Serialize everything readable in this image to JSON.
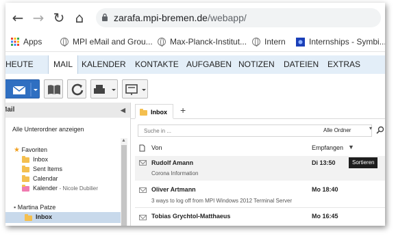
{
  "browser": {
    "url_host": "zarafa.mpi-bremen.de",
    "url_path": "/webapp/",
    "bookmarks": [
      {
        "label": "Apps",
        "icon": "apps-grid-icon"
      },
      {
        "label": "MPI eMail and Grou...",
        "icon": "globe-icon"
      },
      {
        "label": "Max-Planck-Institut...",
        "icon": "globe-icon"
      },
      {
        "label": "Intern",
        "icon": "globe-icon"
      },
      {
        "label": "Internships - Symbi...",
        "icon": "bookmark-favicon-icon"
      }
    ]
  },
  "nav": {
    "tabs": [
      "HEUTE",
      "MAIL",
      "KALENDER",
      "KONTAKTE",
      "AUFGABEN",
      "NOTIZEN",
      "DATEIEN",
      "EXTRAS"
    ],
    "active": "MAIL"
  },
  "left": {
    "header": "Mail",
    "show_subfolders": "Alle Unterordner anzeigen",
    "favorites_label": "Favoriten",
    "favorites": [
      {
        "label": "Inbox",
        "extra": ""
      },
      {
        "label": "Sent Items",
        "extra": ""
      },
      {
        "label": "Calendar",
        "extra": ""
      },
      {
        "label": "Kalender",
        "extra": "- Nicole Dubilier"
      }
    ],
    "store_label": "Martina Patze",
    "store_inbox": "Inbox"
  },
  "right": {
    "tab_label": "Inbox",
    "search_placeholder": "Suche in ...",
    "search_scope": "Alle Ordner",
    "col_from": "Von",
    "col_received": "Empfangen",
    "sort_tooltip": "Sortieren",
    "messages": [
      {
        "from": "Rudolf Amann",
        "subject": "Corona Information",
        "date": "Di 13:50"
      },
      {
        "from": "Oliver Artmann",
        "subject": "3 ways to log off from MPI Windows 2012 Terminal Server",
        "date": "Mo 18:40"
      },
      {
        "from": "Tobias Grychtol-Matthaeus",
        "subject": "",
        "date": "Mo 16:45"
      }
    ]
  },
  "colors": {
    "nav_bg": "#e3eef8",
    "selection_bg": "#c8d9eb",
    "folder_yellow": "#f4bf4f",
    "favorite_star": "#f0a020"
  }
}
